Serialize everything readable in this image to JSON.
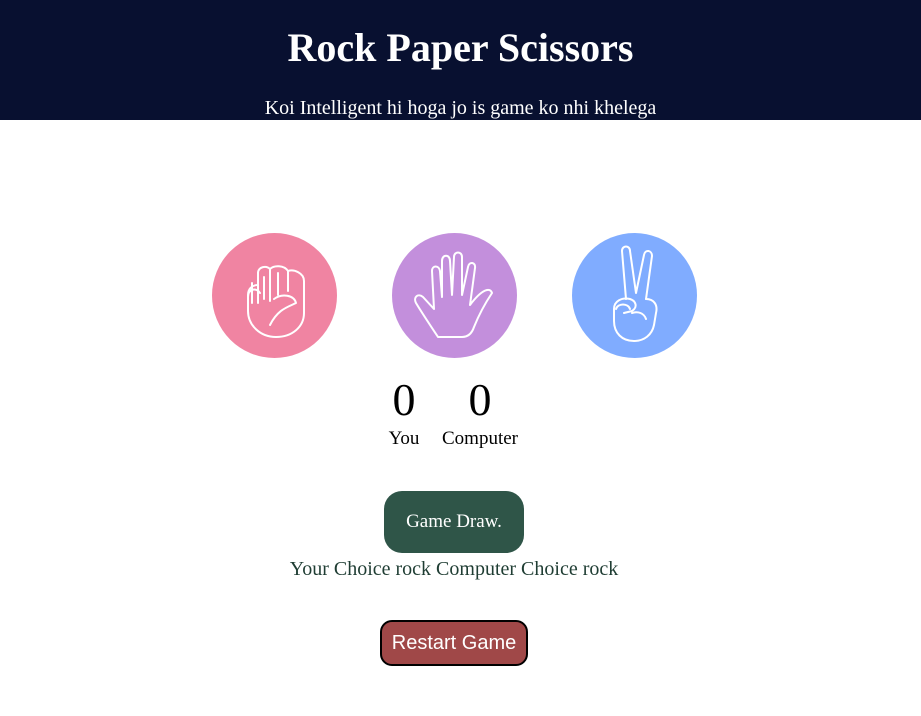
{
  "header": {
    "title": "Rock Paper Scissors",
    "subtitle": "Koi Intelligent hi hoga jo is game ko nhi khelega"
  },
  "choices": [
    {
      "id": "rock",
      "icon": "fist-icon",
      "color": "#f084a2"
    },
    {
      "id": "paper",
      "icon": "open-hand-icon",
      "color": "#c38fdc"
    },
    {
      "id": "scissors",
      "icon": "peace-hand-icon",
      "color": "#80acff"
    }
  ],
  "score": {
    "user": "0",
    "user_label": "You",
    "computer": "0",
    "computer_label": "Computer"
  },
  "message": {
    "text": "Game Draw.",
    "color": "#2f5548"
  },
  "result_text": "Your Choice rock Computer Choice rock",
  "restart": {
    "label": "Restart Game",
    "color": "#a04848"
  },
  "colors": {
    "header_bg": "#081030"
  }
}
